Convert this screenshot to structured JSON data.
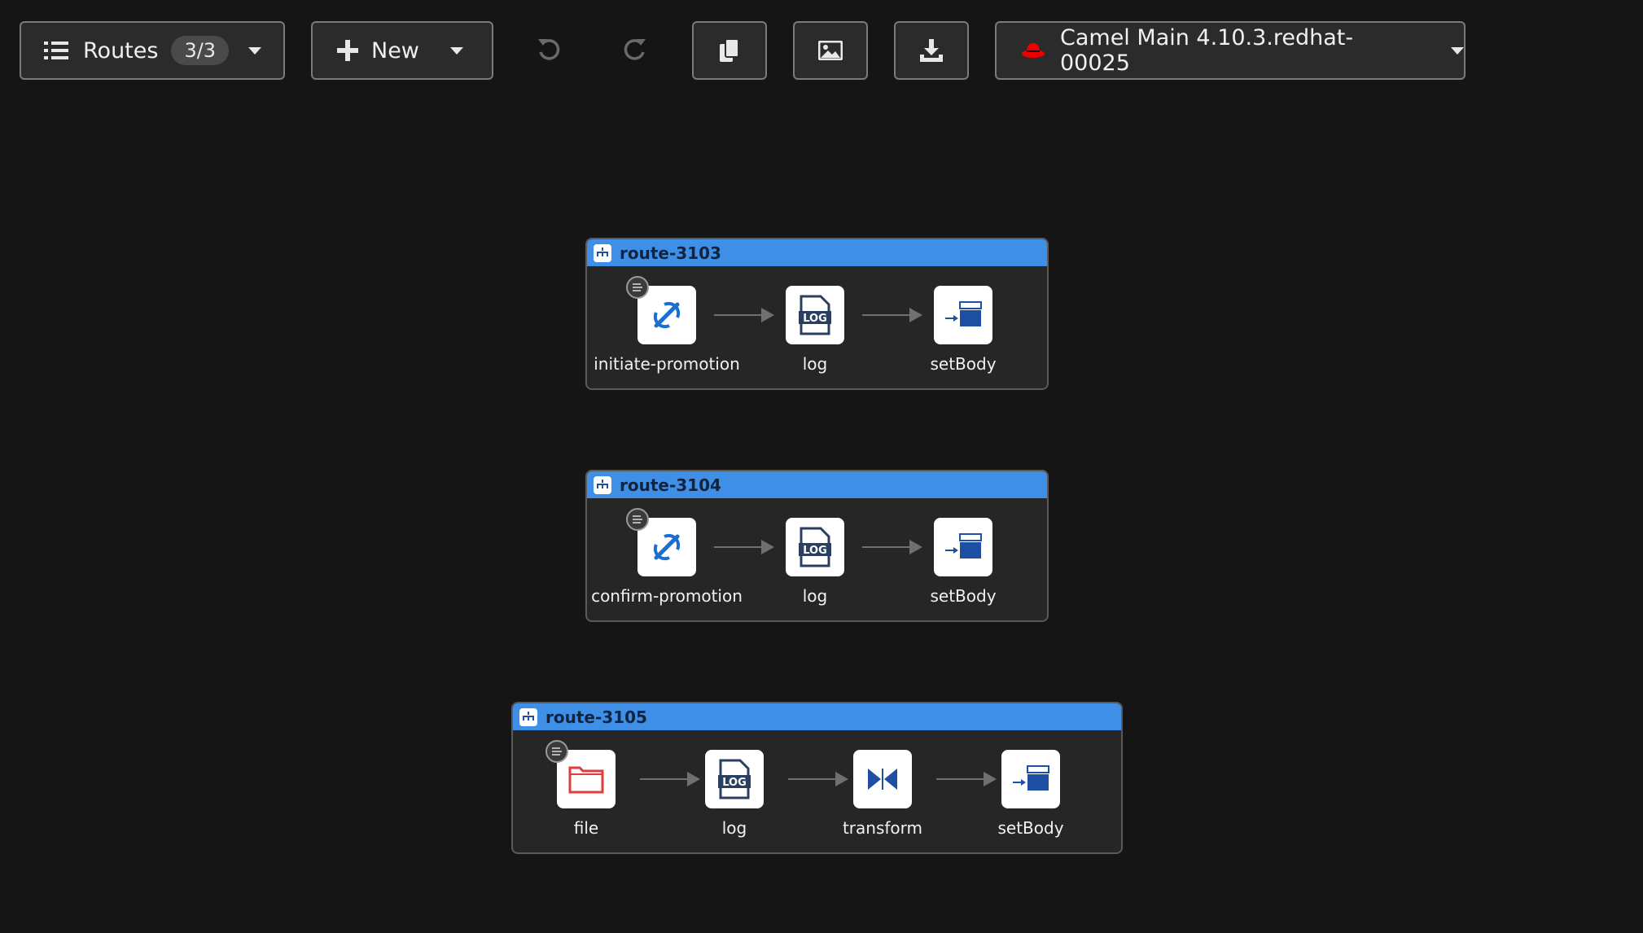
{
  "toolbar": {
    "routes_label": "Routes",
    "routes_count": "3/3",
    "new_label": "New",
    "runtime_label": "Camel Main 4.10.3.redhat-00025"
  },
  "routes": [
    {
      "name": "route-3103",
      "nodes": [
        {
          "label": "initiate-promotion",
          "icon": "kamelet-icon"
        },
        {
          "label": "log",
          "icon": "log-icon"
        },
        {
          "label": "setBody",
          "icon": "set-body-icon"
        }
      ]
    },
    {
      "name": "route-3104",
      "nodes": [
        {
          "label": "confirm-promotion",
          "icon": "kamelet-icon"
        },
        {
          "label": "log",
          "icon": "log-icon"
        },
        {
          "label": "setBody",
          "icon": "set-body-icon"
        }
      ]
    },
    {
      "name": "route-3105",
      "nodes": [
        {
          "label": "file",
          "icon": "folder-icon"
        },
        {
          "label": "log",
          "icon": "log-icon"
        },
        {
          "label": "transform",
          "icon": "transform-icon"
        },
        {
          "label": "setBody",
          "icon": "set-body-icon"
        }
      ]
    }
  ],
  "colors": {
    "background": "#151515",
    "route_header": "#3f8fe6",
    "kamelet_blue": "#1a6fd1",
    "file_red": "#e23b3b",
    "eip_blue": "#1f4fa3"
  }
}
